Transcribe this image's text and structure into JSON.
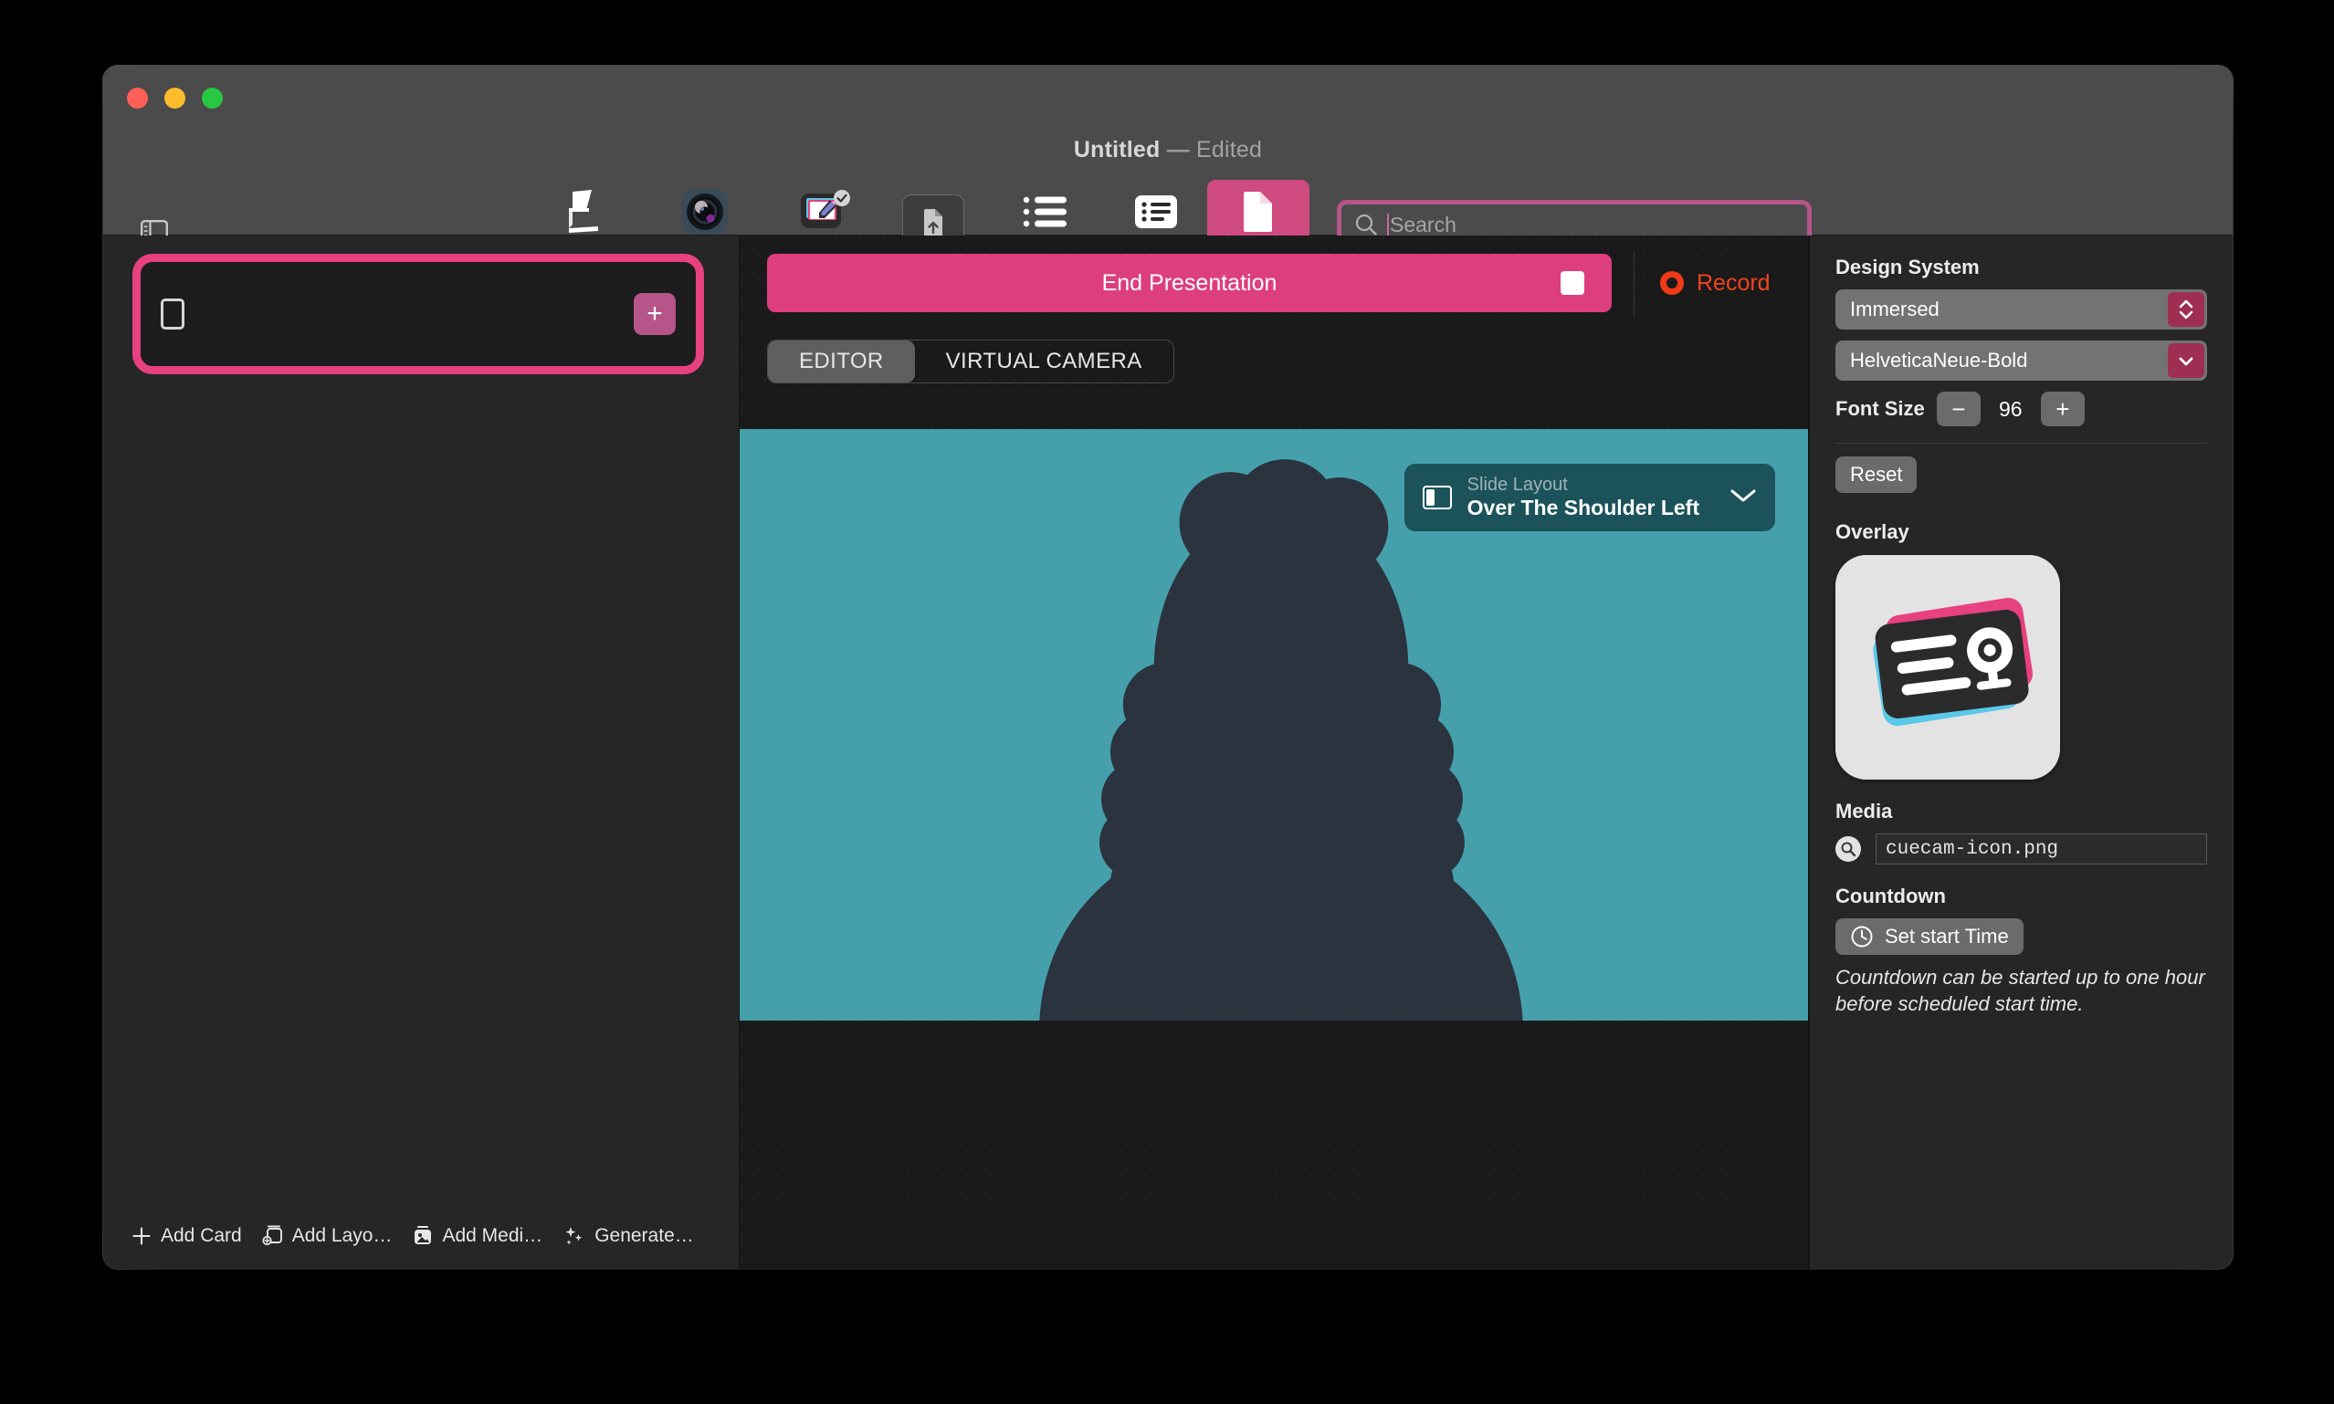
{
  "window": {
    "title_main": "Untitled",
    "title_dash": "—",
    "title_sub": "Edited"
  },
  "toolbar": {
    "sidebar_toggle_name": "Toggle Sidebar",
    "items": [
      {
        "label": "Teleprompter",
        "icon": "teleprompter-icon"
      },
      {
        "label": "Shoot",
        "icon": "camera-lens-icon"
      },
      {
        "label": "Video Pencil",
        "icon": "video-pencil-icon"
      },
      {
        "label": "Dashboard",
        "icon": "list-dashboard-icon"
      },
      {
        "label": "Card",
        "icon": "card-list-icon"
      },
      {
        "label": "Doc",
        "icon": "document-icon"
      }
    ],
    "active_item": "Doc",
    "export_icon": "document-upload-icon",
    "accent_pink": "#cf4a7e"
  },
  "search": {
    "placeholder": "Search",
    "value": "",
    "icon": "search-icon",
    "focus_ring_color": "#b5558a"
  },
  "left_panel": {
    "card_slot": {
      "mini_icon": "card-placeholder-icon",
      "add_label": "+",
      "highlight_color": "#e8417f"
    },
    "bottom_actions": [
      {
        "label": "Add Card",
        "icon": "plus-icon"
      },
      {
        "label": "Add Layo…",
        "icon": "add-layout-icon"
      },
      {
        "label": "Add Medi…",
        "icon": "add-media-icon"
      },
      {
        "label": "Generate…",
        "icon": "sparkles-icon"
      }
    ]
  },
  "center_panel": {
    "end_presentation_label": "End Presentation",
    "end_presentation_color": "#dd3e7e",
    "stop_icon": "stop-square-icon",
    "record_label": "Record",
    "record_color": "#f0441f",
    "record_icon": "record-dot-icon",
    "tabs": [
      {
        "label": "EDITOR",
        "selected": true
      },
      {
        "label": "VIRTUAL CAMERA",
        "selected": false
      }
    ],
    "video": {
      "background_color": "#45a0ac",
      "subject": "person-silhouette",
      "slide_layout": {
        "caption": "Slide Layout",
        "value": "Over The Shoulder Left",
        "icon": "layout-left-icon",
        "chevron": "chevron-down-icon"
      }
    }
  },
  "right_panel": {
    "design_system": {
      "title": "Design System",
      "theme_value": "Immersed",
      "font_value": "HelveticaNeue-Bold",
      "font_size_label": "Font Size",
      "font_size_value": "96",
      "decrement_label": "−",
      "increment_label": "+",
      "reset_label": "Reset",
      "stepper_color": "#9e2f52"
    },
    "overlay": {
      "title": "Overlay",
      "thumbnail_name": "cuecam-app-icon"
    },
    "media": {
      "title": "Media",
      "icon": "media-search-icon",
      "filename": "cuecam-icon.png"
    },
    "countdown": {
      "title": "Countdown",
      "button_label": "Set start Time",
      "button_icon": "clock-icon",
      "note": "Countdown can be started up to one hour before scheduled start time."
    }
  }
}
